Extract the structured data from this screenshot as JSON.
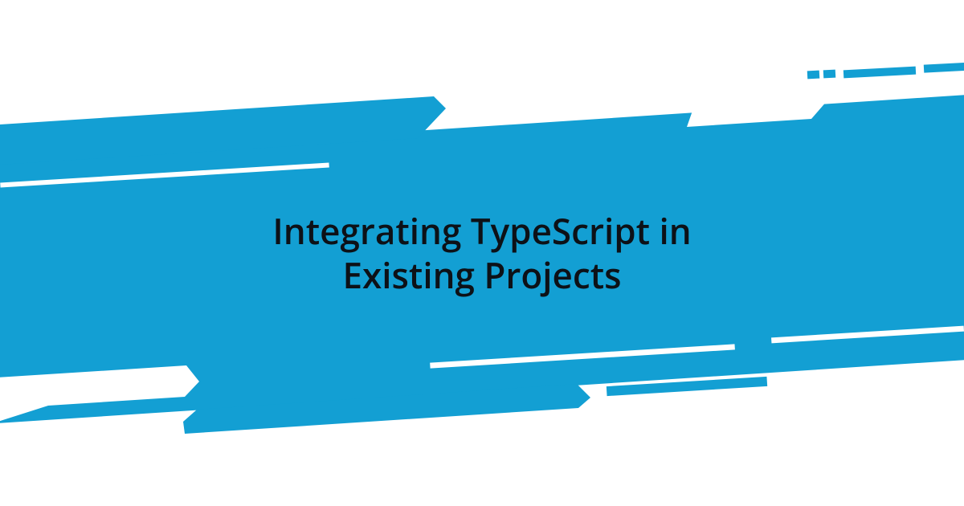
{
  "title_line1": "Integrating TypeScript in",
  "title_line2": "Existing Projects",
  "colors": {
    "primary": "#139fd3",
    "text": "#0d1117",
    "background": "#ffffff"
  }
}
